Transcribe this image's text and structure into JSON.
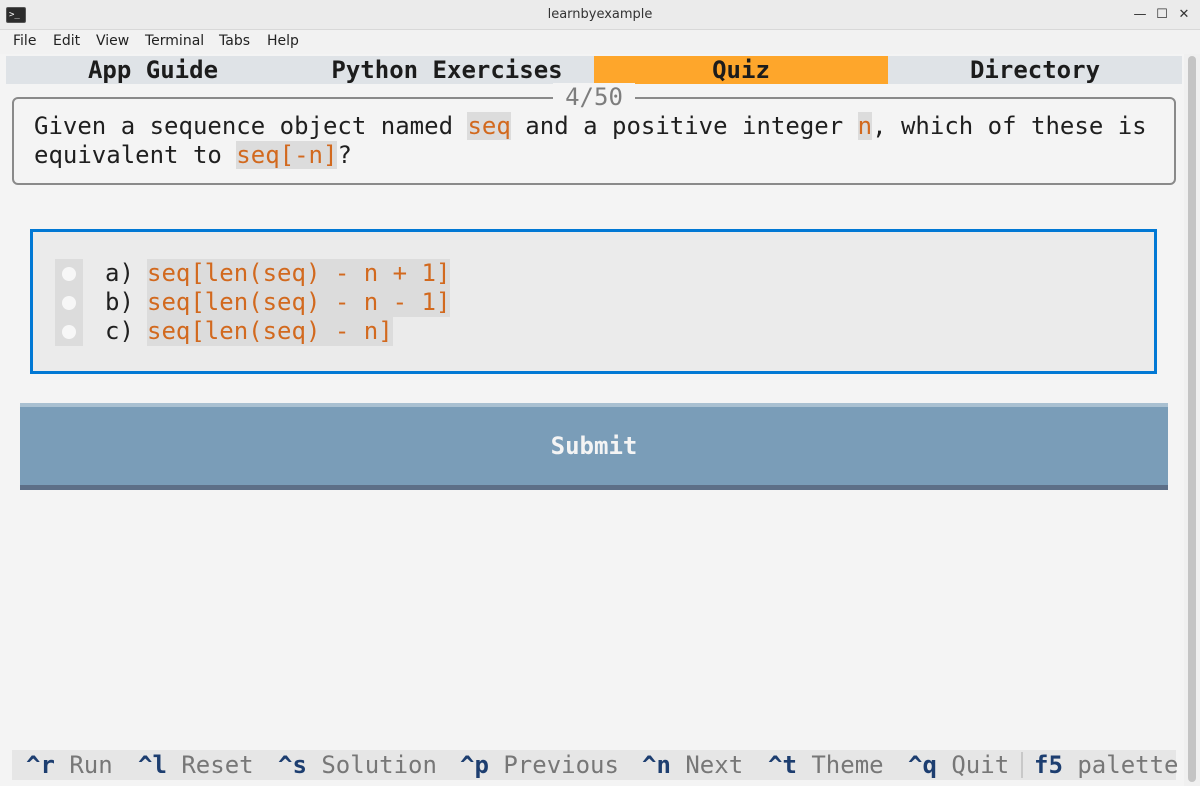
{
  "window": {
    "title": "learnbyexample",
    "icon": "terminal-icon",
    "minimize_glyph": "—",
    "maximize_glyph": "☐",
    "close_glyph": "✕"
  },
  "menubar": [
    "File",
    "Edit",
    "View",
    "Terminal",
    "Tabs",
    "Help"
  ],
  "tabs": [
    {
      "label": "App Guide",
      "active": false
    },
    {
      "label": "Python Exercises",
      "active": false
    },
    {
      "label": "Quiz",
      "active": true
    },
    {
      "label": "Directory",
      "active": false
    }
  ],
  "question": {
    "counter": "4/50",
    "line1": {
      "pre": "Given a sequence object named ",
      "code1": "seq",
      "mid": " and a positive integer ",
      "code2": "n",
      "post": ", which of these is"
    },
    "line2": {
      "pre": "equivalent to ",
      "code": "seq[-n]",
      "post": "?"
    }
  },
  "options": [
    {
      "letter": "a)",
      "text": "seq[len(seq) - n + 1]"
    },
    {
      "letter": "b)",
      "text": "seq[len(seq) - n - 1]"
    },
    {
      "letter": "c)",
      "text": "seq[len(seq) - n]"
    }
  ],
  "submit_label": "Submit",
  "footer": [
    {
      "key": "^r",
      "desc": "Run"
    },
    {
      "key": "^l",
      "desc": "Reset"
    },
    {
      "key": "^s",
      "desc": "Solution"
    },
    {
      "key": "^p",
      "desc": "Previous"
    },
    {
      "key": "^n",
      "desc": "Next"
    },
    {
      "key": "^t",
      "desc": "Theme"
    },
    {
      "key": "^q",
      "desc": "Quit"
    },
    {
      "key": "f5",
      "desc": "palette"
    }
  ],
  "colors": {
    "accent": "#fea62b",
    "focus_border": "#0178d4",
    "code": "#d2691e",
    "submit": "#7a9db8"
  }
}
